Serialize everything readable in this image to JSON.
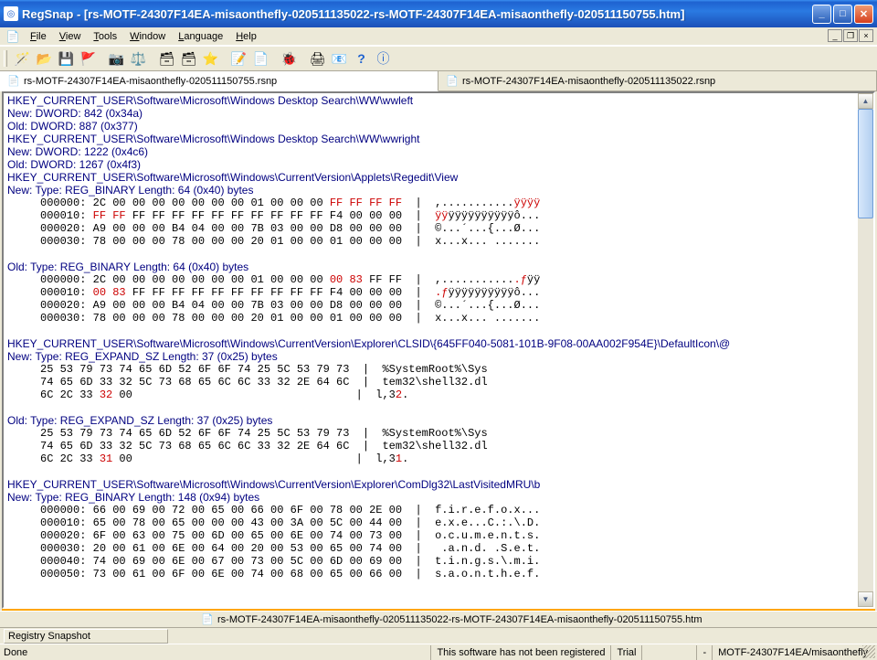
{
  "app_name": "RegSnap",
  "doc_name": "rs-MOTF-24307F14EA-misaonthefly-020511135022-rs-MOTF-24307F14EA-misaonthefly-020511150755.htm",
  "title": "RegSnap - [rs-MOTF-24307F14EA-misaonthefly-020511135022-rs-MOTF-24307F14EA-misaonthefly-020511150755.htm]",
  "menu": {
    "file": "File",
    "view": "View",
    "tools": "Tools",
    "window": "Window",
    "language": "Language",
    "help": "Help"
  },
  "toolbar_icons": [
    "wand-icon",
    "open-icon",
    "save-icon",
    "flag-icon",
    "",
    "camera-icon",
    "scale-icon",
    "",
    "shot1-icon",
    "shot2-icon",
    "star-icon",
    "",
    "edit1-icon",
    "edit2-icon",
    "",
    "bug-icon",
    "",
    "print-icon",
    "mail-icon",
    "help-icon",
    "info-icon"
  ],
  "tabs": [
    {
      "label": "rs-MOTF-24307F14EA-misaonthefly-020511150755.rsnp",
      "active": true
    },
    {
      "label": "rs-MOTF-24307F14EA-misaonthefly-020511135022.rsnp",
      "active": false
    }
  ],
  "content": {
    "lines": [
      {
        "t": "key",
        "v": "HKEY_CURRENT_USER\\Software\\Microsoft\\Windows Desktop Search\\WW\\wwleft"
      },
      {
        "t": "nv",
        "v": "New: DWORD: 842 (0x34a)"
      },
      {
        "t": "nv",
        "v": "Old: DWORD: 887 (0x377)"
      },
      {
        "t": "key",
        "v": "HKEY_CURRENT_USER\\Software\\Microsoft\\Windows Desktop Search\\WW\\wwright"
      },
      {
        "t": "nv",
        "v": "New: DWORD: 1222 (0x4c6)"
      },
      {
        "t": "nv",
        "v": "Old: DWORD: 1267 (0x4f3)"
      },
      {
        "t": "key",
        "v": "HKEY_CURRENT_USER\\Software\\Microsoft\\Windows\\CurrentVersion\\Applets\\Regedit\\View"
      },
      {
        "t": "nv",
        "v": "New: Type: REG_BINARY Length: 64 (0x40) bytes"
      },
      {
        "t": "hex",
        "pre": "     000000: 2C 00 00 00 00 00 00 00 01 00 00 00 ",
        "red": "FF FF FF FF",
        "post": "  |  ,...........",
        "ared": "ÿÿÿÿ",
        "apost": ""
      },
      {
        "t": "hex",
        "pre": "     000010: ",
        "red": "FF FF",
        "post": " FF FF FF FF FF FF FF FF FF FF F4 00 00 00  |  ",
        "ared": "ÿÿ",
        "apost": "ÿÿÿÿÿÿÿÿÿÿô..."
      },
      {
        "t": "hex",
        "pre": "     000020: A9 00 00 00 B4 04 00 00 7B 03 00 00 D8 00 00 00  |  ©...´...{...Ø..."
      },
      {
        "t": "hex",
        "pre": "     000030: 78 00 00 00 78 00 00 00 20 01 00 00 01 00 00 00  |  x...x... ......."
      },
      {
        "t": "blank"
      },
      {
        "t": "nv",
        "v": "Old: Type: REG_BINARY Length: 64 (0x40) bytes"
      },
      {
        "t": "hex",
        "pre": "     000000: 2C 00 00 00 00 00 00 00 01 00 00 00 ",
        "red": "00 83 ",
        "post": "FF FF  |  ,...........",
        "ared": ".ƒ",
        "apost": "ÿÿ"
      },
      {
        "t": "hex",
        "pre": "     000010: ",
        "red": "00 83",
        "post": " FF FF FF FF FF FF FF FF FF FF F4 00 00 00  |  ",
        "ared": ".ƒ",
        "apost": "ÿÿÿÿÿÿÿÿÿÿô..."
      },
      {
        "t": "hex",
        "pre": "     000020: A9 00 00 00 B4 04 00 00 7B 03 00 00 D8 00 00 00  |  ©...´...{...Ø..."
      },
      {
        "t": "hex",
        "pre": "     000030: 78 00 00 00 78 00 00 00 20 01 00 00 01 00 00 00  |  x...x... ......."
      },
      {
        "t": "blank"
      },
      {
        "t": "key",
        "v": "HKEY_CURRENT_USER\\Software\\Microsoft\\Windows\\CurrentVersion\\Explorer\\CLSID\\{645FF040-5081-101B-9F08-00AA002F954E}\\DefaultIcon\\@"
      },
      {
        "t": "nv",
        "v": "New: Type: REG_EXPAND_SZ Length: 37 (0x25) bytes"
      },
      {
        "t": "hex",
        "pre": "     25 53 79 73 74 65 6D 52 6F 6F 74 25 5C 53 79 73  |  %SystemRoot%\\Sys"
      },
      {
        "t": "hex",
        "pre": "     74 65 6D 33 32 5C 73 68 65 6C 6C 33 32 2E 64 6C  |  tem32\\shell32.dl"
      },
      {
        "t": "hex",
        "pre": "     6C 2C 33 ",
        "red": "32",
        "post": " 00                                  |  l,3",
        "ared": "2",
        "apost": "."
      },
      {
        "t": "blank"
      },
      {
        "t": "nv",
        "v": "Old: Type: REG_EXPAND_SZ Length: 37 (0x25) bytes"
      },
      {
        "t": "hex",
        "pre": "     25 53 79 73 74 65 6D 52 6F 6F 74 25 5C 53 79 73  |  %SystemRoot%\\Sys"
      },
      {
        "t": "hex",
        "pre": "     74 65 6D 33 32 5C 73 68 65 6C 6C 33 32 2E 64 6C  |  tem32\\shell32.dl"
      },
      {
        "t": "hex",
        "pre": "     6C 2C 33 ",
        "red": "31",
        "post": " 00                                  |  l,3",
        "ared": "1",
        "apost": "."
      },
      {
        "t": "blank"
      },
      {
        "t": "key",
        "v": "HKEY_CURRENT_USER\\Software\\Microsoft\\Windows\\CurrentVersion\\Explorer\\ComDlg32\\LastVisitedMRU\\b"
      },
      {
        "t": "nv",
        "v": "New: Type: REG_BINARY Length: 148 (0x94) bytes"
      },
      {
        "t": "hex",
        "pre": "     000000: 66 00 69 00 72 00 65 00 66 00 6F 00 78 00 2E 00  |  f.i.r.e.f.o.x..."
      },
      {
        "t": "hex",
        "pre": "     000010: 65 00 78 00 65 00 00 00 43 00 3A 00 5C 00 44 00  |  e.x.e...C.:.\\.D."
      },
      {
        "t": "hex",
        "pre": "     000020: 6F 00 63 00 75 00 6D 00 65 00 6E 00 74 00 73 00  |  o.c.u.m.e.n.t.s."
      },
      {
        "t": "hex",
        "pre": "     000030: 20 00 61 00 6E 00 64 00 20 00 53 00 65 00 74 00  |   .a.n.d. .S.e.t."
      },
      {
        "t": "hex",
        "pre": "     000040: 74 00 69 00 6E 00 67 00 73 00 5C 00 6D 00 69 00  |  t.i.n.g.s.\\.m.i."
      },
      {
        "t": "hex",
        "pre": "     000050: 73 00 61 00 6F 00 6E 00 74 00 68 00 65 00 66 00  |  s.a.o.n.t.h.e.f."
      }
    ]
  },
  "docpath": "rs-MOTF-24307F14EA-misaonthefly-020511135022-rs-MOTF-24307F14EA-misaonthefly-020511150755.htm",
  "status1": {
    "cell": "Registry Snapshot"
  },
  "status2": {
    "left": "Done",
    "msg": "This software has not been registered",
    "trial": "Trial",
    "dash": "-",
    "path": "MOTF-24307F14EA/misaonthefly"
  }
}
